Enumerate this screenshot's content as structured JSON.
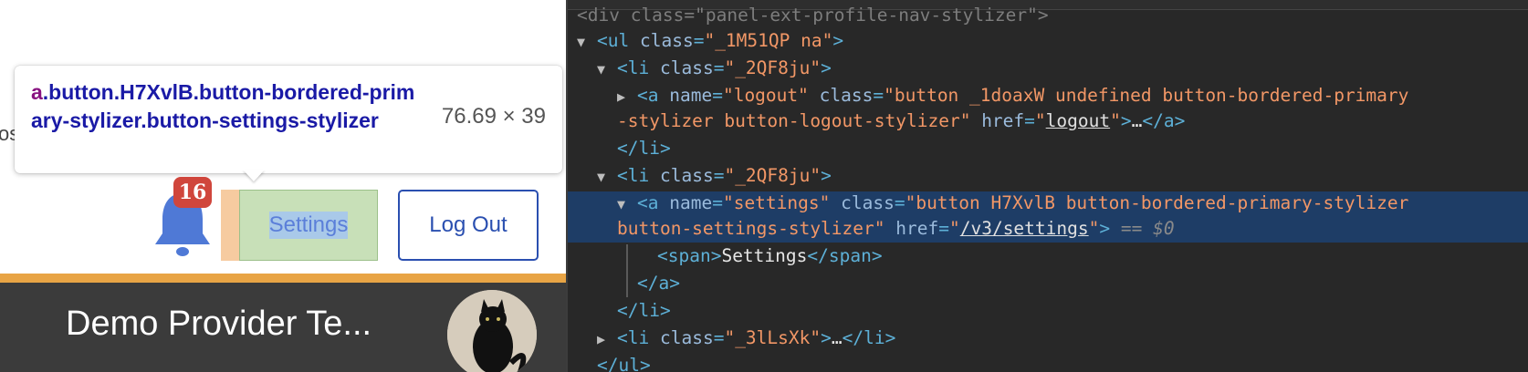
{
  "page": {
    "cut_text": "os",
    "tooltip": {
      "tag": "a",
      "selector_rest": ".button.H7XvlB.button-bordered-primary-stylizer.button-settings-stylizer",
      "size": "76.69 × 39"
    },
    "badge_count": "16",
    "settings_label": "Settings",
    "logout_label": "Log Out",
    "provider_name": "Demo Provider Te...",
    "colors": {
      "accent_orange": "#e8a445",
      "badge_red": "#d0463c",
      "bell_blue": "#4f79d6",
      "logout_blue": "#2a4fb0"
    }
  },
  "devtools": {
    "top_partial": "<div class=\"panel-ext-profile-nav-stylizer\">",
    "ul_open": {
      "tag": "ul",
      "attr": "class",
      "value": "_1M51QP na"
    },
    "li1": {
      "tag": "li",
      "attr": "class",
      "value": "_2QF8ju"
    },
    "a_logout": {
      "name_value": "logout",
      "class_value_line1": "button _1doaxW undefined button-bordered-primary",
      "class_value_line2": "-stylizer button-logout-stylizer",
      "href": "logout",
      "ellipsis": "…"
    },
    "li_close": "</li>",
    "li2": {
      "tag": "li",
      "attr": "class",
      "value": "_2QF8ju"
    },
    "a_settings": {
      "name_value": "settings",
      "class_value_line1": "button H7XvlB button-bordered-primary-stylizer",
      "class_value_line2": "button-settings-stylizer",
      "href": "/v3/settings",
      "eq_marker": "== $0"
    },
    "span_text": "Settings",
    "a_close": "</a>",
    "li3": {
      "tag": "li",
      "attr": "class",
      "value": "_3lLsXk",
      "ellipsis": "…"
    },
    "ul_close": "</ul>"
  }
}
